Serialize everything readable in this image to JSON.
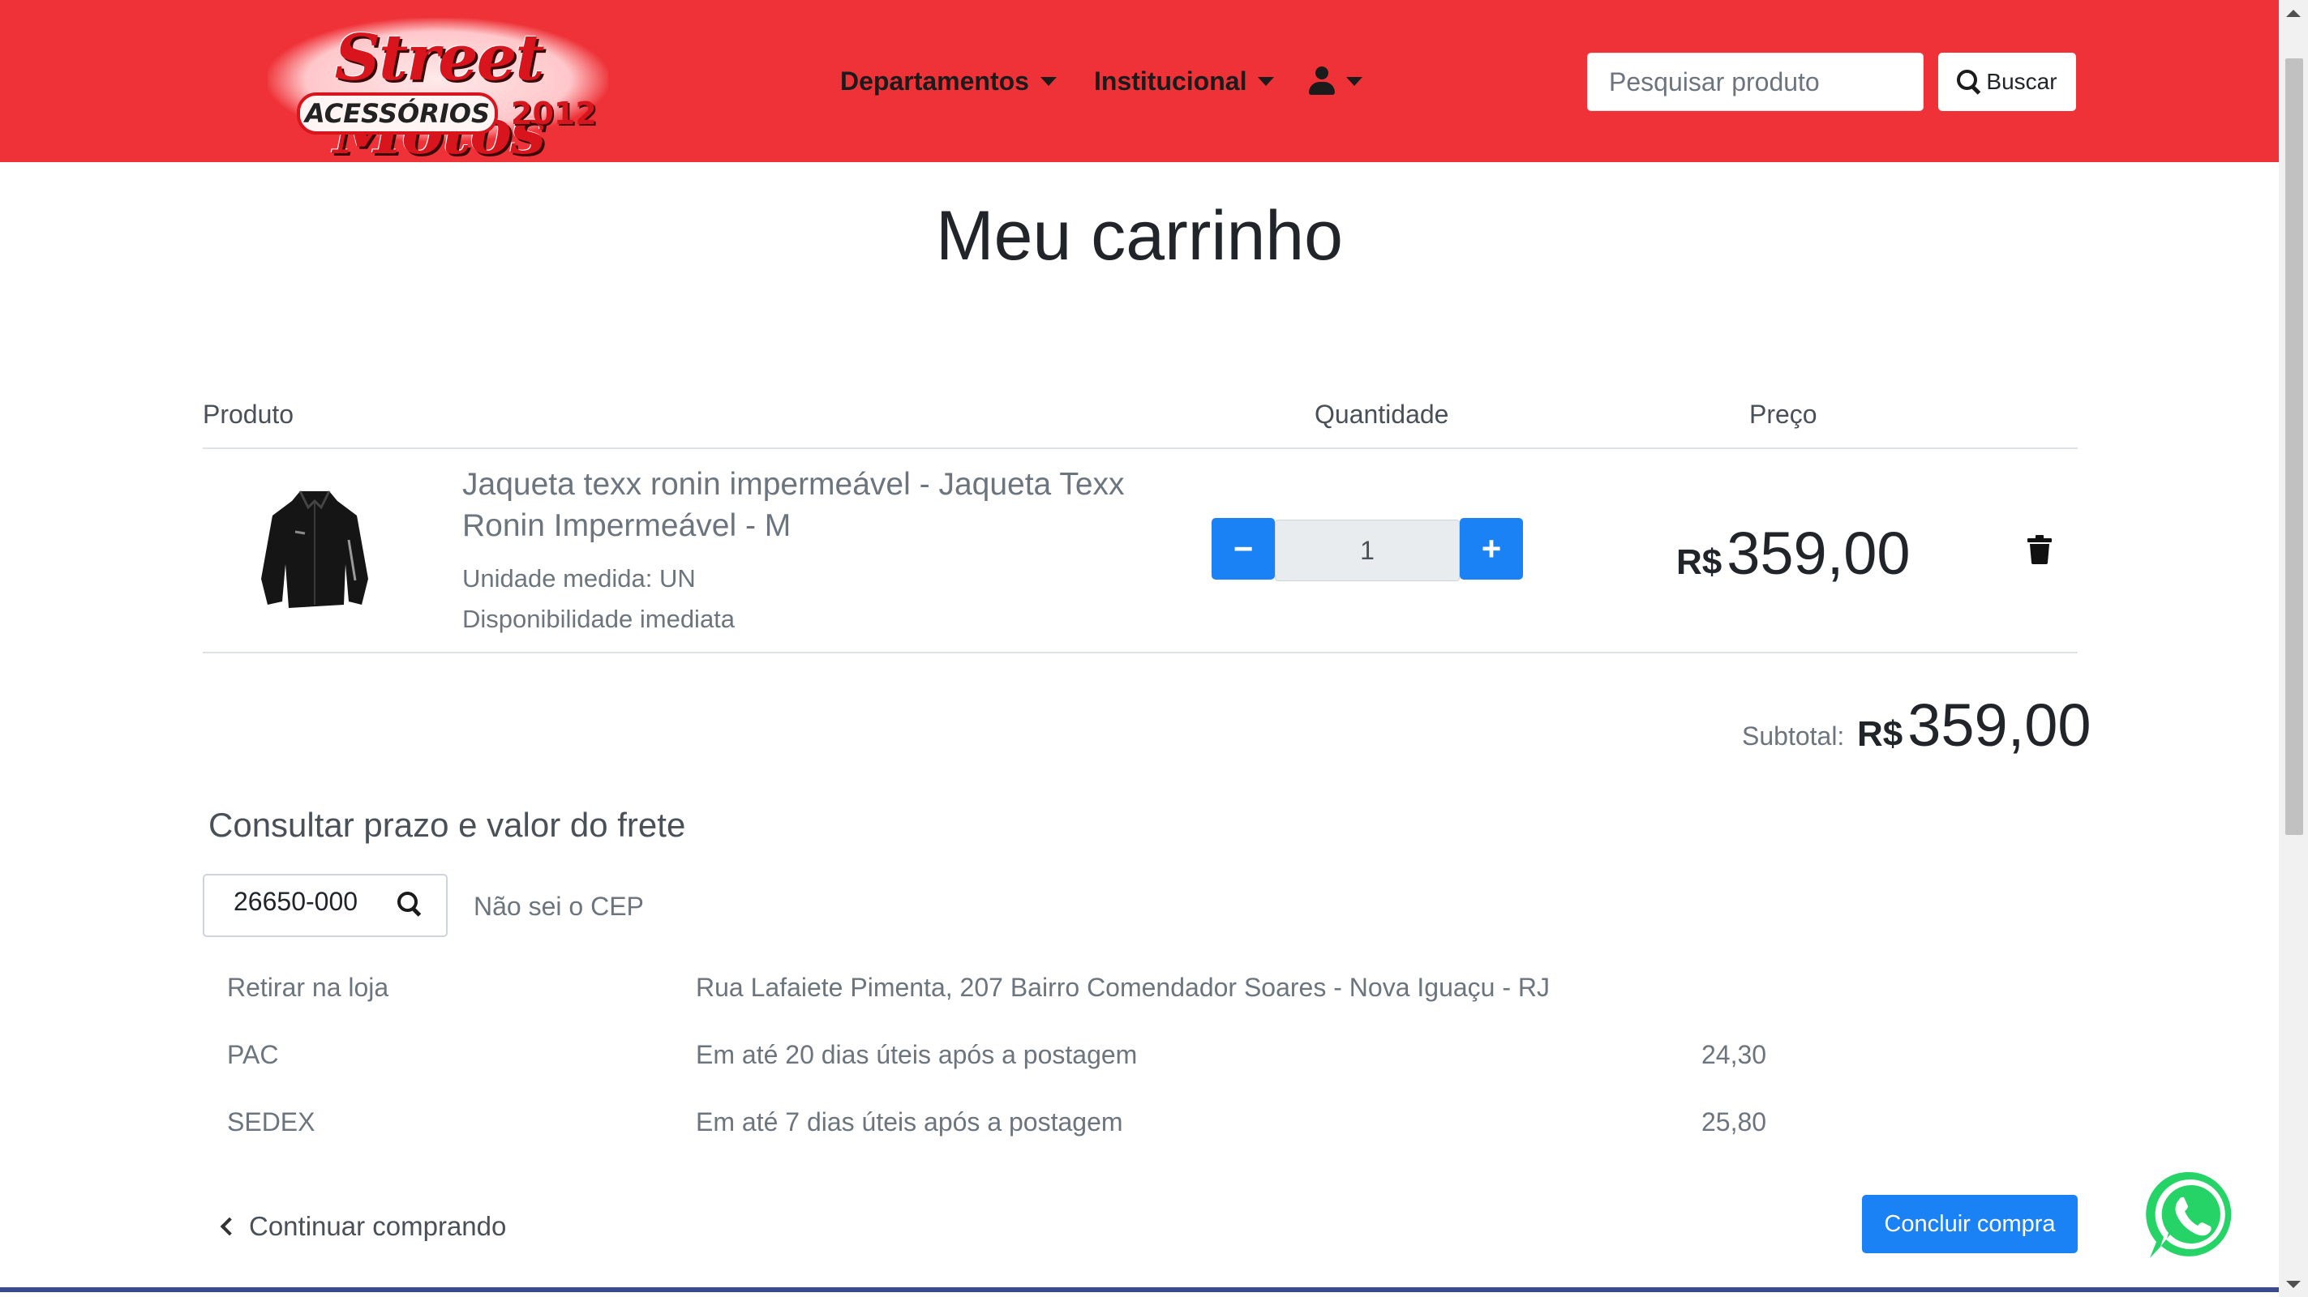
{
  "header": {
    "logo": {
      "line1": "Street Motos",
      "line2": "ACESSÓRIOS",
      "since": "2012"
    },
    "nav": {
      "departments": "Departamentos",
      "institutional": "Institucional",
      "user_menu_icon": "user-icon"
    },
    "search": {
      "placeholder": "Pesquisar produto",
      "value": "",
      "button_label": "Buscar",
      "button_icon": "search-icon"
    }
  },
  "page_title": "Meu carrinho",
  "cart": {
    "columns": {
      "product": "Produto",
      "quantity": "Quantidade",
      "price": "Preço"
    },
    "items": [
      {
        "name": "Jaqueta texx ronin impermeável - Jaqueta Texx Ronin Impermeável - M",
        "unit": "Unidade medida: UN",
        "availability": "Disponibilidade imediata",
        "quantity": "1",
        "decrease_label": "−",
        "increase_label": "+",
        "currency": "R$",
        "price": "359,00",
        "remove_icon": "trash-icon"
      }
    ],
    "subtotal": {
      "label": "Subtotal:",
      "currency": "R$",
      "value": "359,00"
    }
  },
  "shipping": {
    "title": "Consultar prazo e valor do frete",
    "cep_value": "26650-000",
    "cep_icon": "search-icon",
    "no_cep_link": "Não sei o CEP",
    "options": [
      {
        "name": "Retirar na loja",
        "description": "Rua Lafaiete Pimenta, 207 Bairro Comendador Soares - Nova Iguaçu - RJ",
        "price": ""
      },
      {
        "name": "PAC",
        "description": "Em até 20 dias úteis após a postagem",
        "price": "24,30"
      },
      {
        "name": "SEDEX",
        "description": "Em até 7 dias úteis após a postagem",
        "price": "25,80"
      }
    ]
  },
  "footer_actions": {
    "continue_label": "Continuar comprando",
    "checkout_label": "Concluir compra",
    "whatsapp_icon": "whatsapp-icon"
  },
  "colors": {
    "header_bg": "#ee3237",
    "primary": "#1a82f5",
    "whatsapp": "#25d366"
  }
}
